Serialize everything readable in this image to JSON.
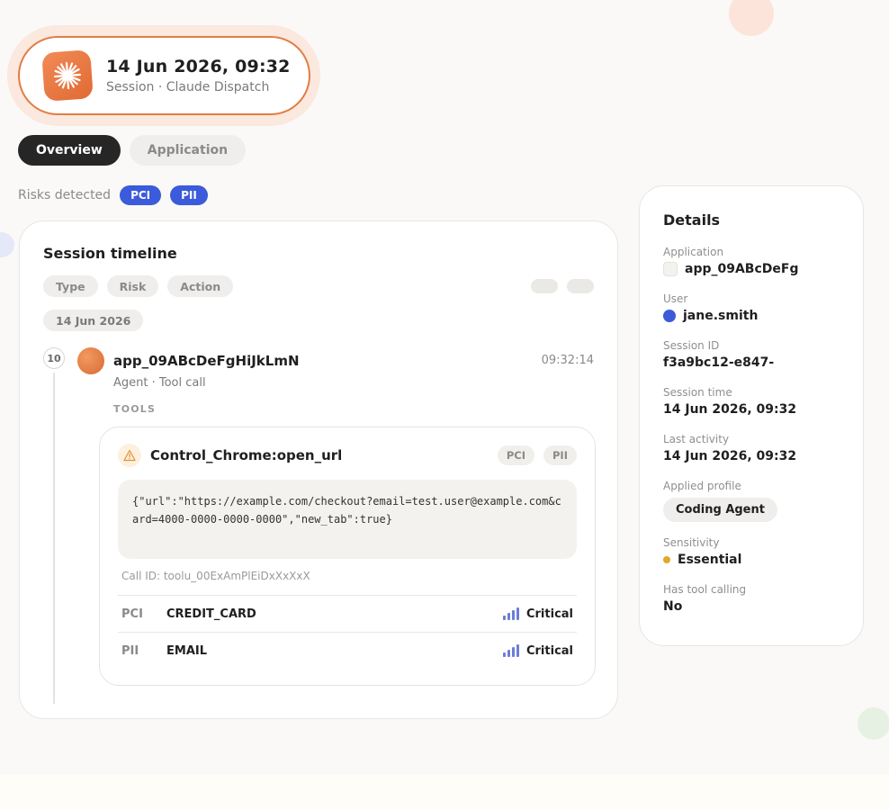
{
  "header": {
    "title": "14 Jun 2026, 09:32",
    "subtitle": "Session · Claude Dispatch",
    "logo_icon": "claude-sunburst-icon",
    "accent": "#e27d44"
  },
  "tabs": [
    {
      "label": "Overview",
      "active": true
    },
    {
      "label": "Application",
      "active": false
    }
  ],
  "risks": {
    "label": "Risks detected",
    "badges": [
      "PCI",
      "PII"
    ],
    "badge_color": "#3b5bdb"
  },
  "timeline": {
    "title": "Session timeline",
    "filters": [
      "Type",
      "Risk",
      "Action"
    ],
    "date": "14 Jun 2026",
    "event": {
      "step": "10",
      "name": "app_09ABcDeFgHiJkLmN",
      "time": "09:32:14",
      "subtitle": "Agent · Tool call",
      "tools_label": "TOOLS",
      "tool": {
        "name": "Control_Chrome:open_url",
        "badges": [
          "PCI",
          "PII"
        ],
        "code": "{\"url\":\"https://example.com/checkout?email=test.user@example.com&card=4000-0000-0000-0000\",\"new_tab\":true}",
        "call_id": "Call ID: toolu_00ExAmPlEiDxXxXxX",
        "findings": [
          {
            "category": "PCI",
            "type": "CREDIT_CARD",
            "severity": "Critical"
          },
          {
            "category": "PII",
            "type": "EMAIL",
            "severity": "Critical"
          }
        ]
      }
    }
  },
  "details": {
    "title": "Details",
    "application": {
      "label": "Application",
      "value": "app_09ABcDeFg"
    },
    "user": {
      "label": "User",
      "value": "jane.smith"
    },
    "session_id": {
      "label": "Session ID",
      "value": "f3a9bc12-e847-"
    },
    "session_time": {
      "label": "Session time",
      "value": "14 Jun 2026, 09:32"
    },
    "last_activity": {
      "label": "Last activity",
      "value": "14 Jun 2026, 09:32"
    },
    "applied_profile": {
      "label": "Applied profile",
      "value": "Coding Agent"
    },
    "sensitivity": {
      "label": "Sensitivity",
      "value": "Essential"
    },
    "tool_calling": {
      "label": "Has tool calling",
      "value": "No"
    }
  }
}
